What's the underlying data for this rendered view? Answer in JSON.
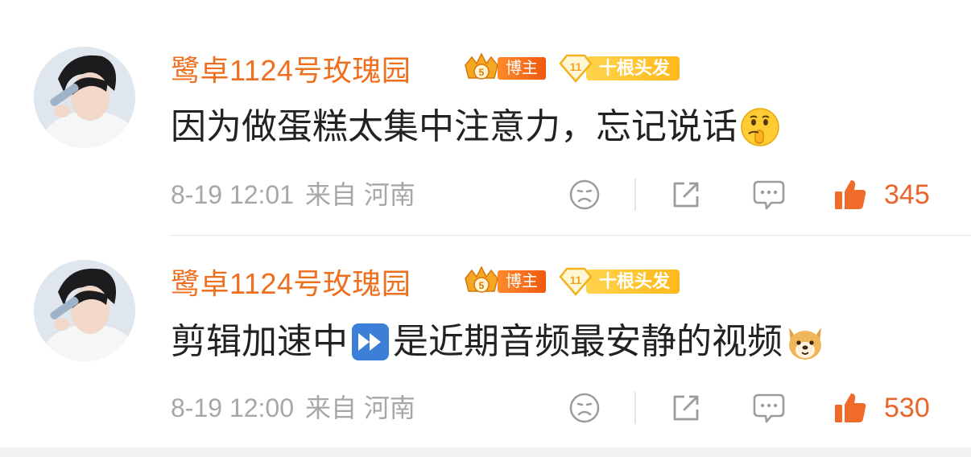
{
  "comments": [
    {
      "username": "鹭卓1124号玫瑰园",
      "badge_blogger": "博主",
      "badge_level": "11",
      "badge_fan": "十根头发",
      "text": "因为做蛋糕太集中注意力，忘记说话",
      "emoji": "shushing-face-emoji",
      "date": "8-19 12:01",
      "source": "来自 河南",
      "likes": "345"
    },
    {
      "username": "鹭卓1124号玫瑰园",
      "badge_blogger": "博主",
      "badge_level": "11",
      "badge_fan": "十根头发",
      "text_before": "剪辑加速中",
      "text_after": "是近期音频最安静的视频",
      "inline_emoji": "fast-forward-emoji",
      "emoji": "dog-face-emoji",
      "date": "8-19 12:00",
      "source": "来自 河南",
      "likes": "530"
    }
  ],
  "colors": {
    "username": "#ee6f1e",
    "like": "#e8642a",
    "meta": "#a7a7a7",
    "text": "#222222"
  }
}
